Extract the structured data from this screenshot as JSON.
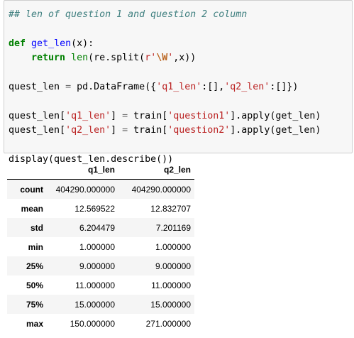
{
  "code": {
    "comment": "## len of question 1 and question 2 column",
    "def_kw": "def",
    "func_name": "get_len",
    "func_params": "(x):",
    "return_kw": "return",
    "len_builtin": "len",
    "split_call": "(re.split(",
    "regex_prefix_str": "r'",
    "regex_escape": "\\W",
    "regex_close_str": "'",
    "split_tail": ",x))",
    "df_lhs": "quest_len",
    "df_op": "=",
    "df_call": "pd.DataFrame({",
    "df_key1": "'q1_len'",
    "df_sep1": ":[],",
    "df_key2": "'q2_len'",
    "df_sep2": ":[]})",
    "assign1_lhs": "quest_len[",
    "assign1_key": "'q1_len'",
    "assign1_mid": "]",
    "assign1_op": "=",
    "assign1_rhs_a": "train[",
    "assign1_rhs_key": "'question1'",
    "assign1_rhs_b": "].apply(get_len)",
    "assign2_lhs": "quest_len[",
    "assign2_key": "'q2_len'",
    "assign2_mid": "]",
    "assign2_op": "=",
    "assign2_rhs_a": "train[",
    "assign2_rhs_key": "'question2'",
    "assign2_rhs_b": "].apply(get_len)",
    "display_line": "display(quest_len.describe())"
  },
  "table": {
    "columns": [
      "q1_len",
      "q2_len"
    ],
    "rows": [
      {
        "index": "count",
        "q1": "404290.000000",
        "q2": "404290.000000"
      },
      {
        "index": "mean",
        "q1": "12.569522",
        "q2": "12.832707"
      },
      {
        "index": "std",
        "q1": "6.204479",
        "q2": "7.201169"
      },
      {
        "index": "min",
        "q1": "1.000000",
        "q2": "1.000000"
      },
      {
        "index": "25%",
        "q1": "9.000000",
        "q2": "9.000000"
      },
      {
        "index": "50%",
        "q1": "11.000000",
        "q2": "11.000000"
      },
      {
        "index": "75%",
        "q1": "15.000000",
        "q2": "15.000000"
      },
      {
        "index": "max",
        "q1": "150.000000",
        "q2": "271.000000"
      }
    ]
  }
}
